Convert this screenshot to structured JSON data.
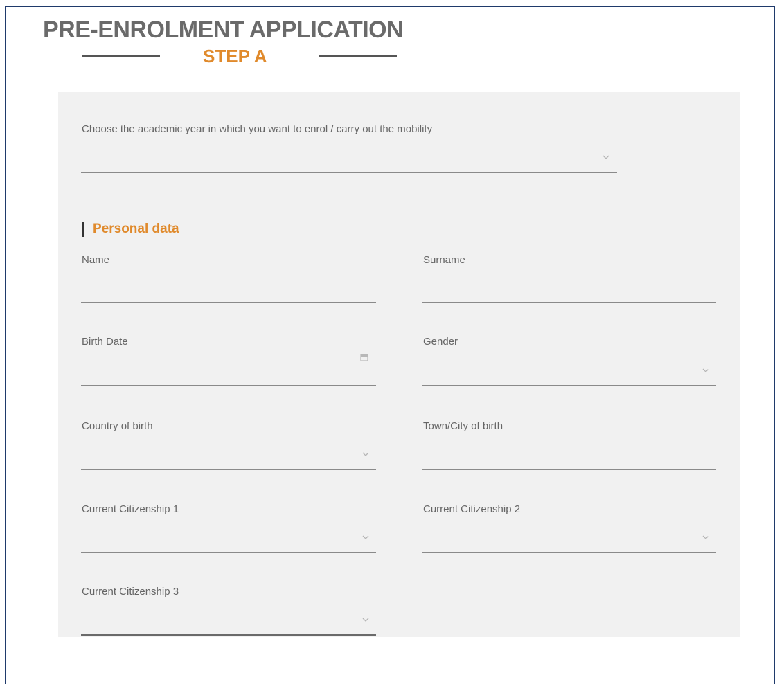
{
  "header": {
    "title": "PRE-ENROLMENT APPLICATION",
    "step": "STEP A"
  },
  "form": {
    "academic_year": {
      "label": "Choose the academic year in which you want to enrol / carry out the mobility",
      "value": ""
    },
    "section_title": "Personal data",
    "fields": {
      "name": {
        "label": "Name",
        "value": ""
      },
      "surname": {
        "label": "Surname",
        "value": ""
      },
      "birth_date": {
        "label": "Birth Date",
        "value": ""
      },
      "gender": {
        "label": "Gender",
        "value": ""
      },
      "country_of_birth": {
        "label": "Country of birth",
        "value": ""
      },
      "town_city_of_birth": {
        "label": "Town/City of birth",
        "value": ""
      },
      "citizenship_1": {
        "label": "Current Citizenship 1",
        "value": ""
      },
      "citizenship_2": {
        "label": "Current Citizenship 2",
        "value": ""
      },
      "citizenship_3": {
        "label": "Current Citizenship 3",
        "value": ""
      }
    }
  },
  "colors": {
    "accent": "#e08a2c",
    "frame_border": "#1f3a6b",
    "panel_bg": "#f1f1f1",
    "title_text": "#6a6a6a"
  },
  "icons": {
    "dropdown": "chevron-down-icon",
    "date": "calendar-icon"
  }
}
